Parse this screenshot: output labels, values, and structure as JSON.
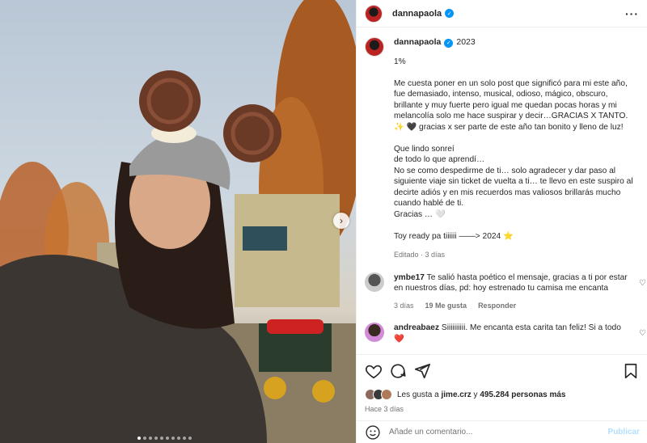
{
  "post": {
    "username": "dannapaola",
    "year": "2023",
    "caption_text": "1%\n\nMe cuesta poner en un solo post que significó para mi este año, fue demasiado, intenso, musical, odioso, mágico, obscuro, brillante y muy fuerte pero igual me quedan pocas horas y mi melancolía solo me hace suspirar y decir…GRACIAS X TANTO. ✨ 🖤 gracias x ser parte de este año tan bonito y lleno de luz!\n\nQue lindo sonreí\nde todo lo que aprendí…\nNo se como despedirme de ti… solo agradecer y dar paso al siguiente viaje sin ticket de vuelta a ti… te llevo en este suspiro al decirte adiós y en mis recuerdos mas valiosos brillarás mucho cuando hablé de ti.\nGracias … 🤍\n\nToy ready pa tiiiiii ——> 2024 ⭐",
    "edited": "Editado · 3 días"
  },
  "comments": [
    {
      "user": "ymbe17",
      "text": "Te salió hasta poético el mensaje, gracias a ti por estar en nuestros días, pd: hoy estrenado tu camisa me encanta",
      "time": "3 días",
      "likes": "19 Me gusta",
      "reply": "Responder"
    },
    {
      "user": "andreabaez",
      "text": "Siiiiiiiiii. Me encanta esta carita tan feliz! Si a todo ❤️"
    }
  ],
  "likes": {
    "prefix": "Les gusta a",
    "user": "jime.crz",
    "middle": "y",
    "count": "495.284 personas más"
  },
  "time_ago": "Hace 3 días",
  "comment_box": {
    "placeholder": "Añade un comentario...",
    "publish": "Publicar"
  },
  "carousel": {
    "slides": 10,
    "active_index": 0
  },
  "colors": {
    "accent": "#0095f6",
    "publish": "#b2dffc",
    "muted": "#737373"
  },
  "icons": [
    "verified-icon",
    "more-options-icon",
    "heart-icon",
    "comment-icon",
    "share-icon",
    "bookmark-icon",
    "emoji-icon",
    "next-arrow-icon"
  ]
}
